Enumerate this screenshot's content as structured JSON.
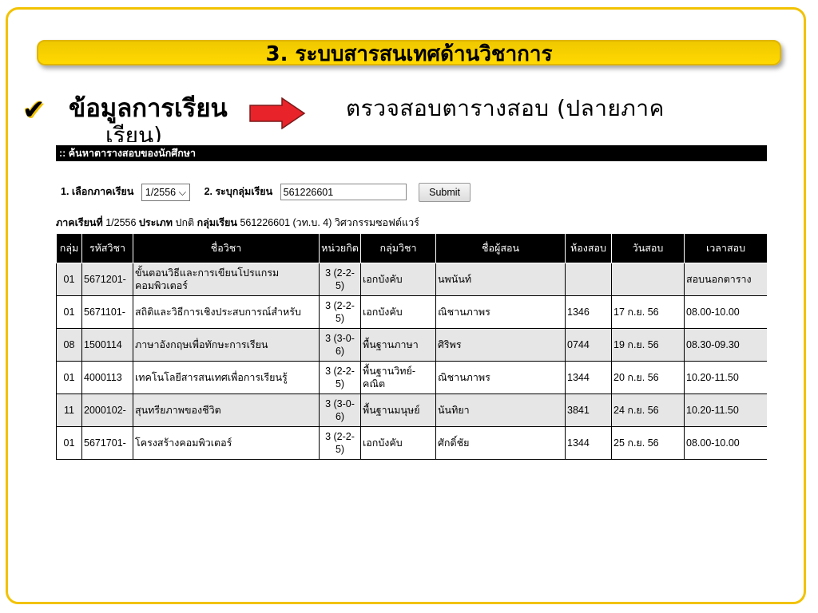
{
  "slide": {
    "title": "3. ระบบสารสนเทศด้านวิชาการ",
    "bullet_label": "ข้อมูลการเรียน",
    "bullet_text_line1": "ตรวจสอบตารางสอบ (ปลายภาค",
    "bullet_text_line2": "เรียน)"
  },
  "screen": {
    "header": ":: ค้นหาตารางสอบของนักศึกษา",
    "form": {
      "step1_label": "1.  เลือกภาคเรียน",
      "semester_value": "1/2556",
      "step2_label": "2.  ระบุกลุ่มเรียน",
      "group_value": "561226601",
      "submit_label": "Submit"
    },
    "info": {
      "semester_label": "ภาคเรียนที่",
      "semester_value": "1/2556",
      "type_label": "ประเภท",
      "type_value": "ปกติ",
      "group_label": "กลุ่มเรียน",
      "group_value": "561226601 (วท.บ. 4) วิศวกรรมซอฟต์แวร์"
    },
    "table": {
      "headers": [
        "กลุ่ม",
        "รหัสวิชา",
        "ชื่อวิชา",
        "หน่วยกิต",
        "กลุ่มวิชา",
        "ชื่อผู้สอน",
        "ห้องสอบ",
        "วันสอบ",
        "เวลาสอบ"
      ],
      "rows": [
        {
          "group": "01",
          "code": "5671201-",
          "name": "ขั้นตอนวิธีและการเขียนโปรแกรมคอมพิวเตอร์",
          "credit": "3 (2-2-5)",
          "category": "เอกบังคับ",
          "teacher": "นพนันท์",
          "room": "",
          "date": "",
          "time": "สอบนอกตาราง"
        },
        {
          "group": "01",
          "code": "5671101-",
          "name": "สถิติและวิธีการเชิงประสบการณ์สำหรับ",
          "credit": "3 (2-2-5)",
          "category": "เอกบังคับ",
          "teacher": "ณิชานภาพร",
          "room": "1346",
          "date": "17 ก.ย. 56",
          "time": "08.00-10.00"
        },
        {
          "group": "08",
          "code": "1500114",
          "name": "ภาษาอังกฤษเพื่อทักษะการเรียน",
          "credit": "3 (3-0-6)",
          "category": "พื้นฐานภาษา",
          "teacher": "ศิริพร",
          "room": "0744",
          "date": "19 ก.ย. 56",
          "time": "08.30-09.30"
        },
        {
          "group": "01",
          "code": "4000113",
          "name": "เทคโนโลยีสารสนเทศเพื่อการเรียนรู้",
          "credit": "3 (2-2-5)",
          "category": "พื้นฐานวิทย์-คณิต",
          "teacher": "ณิชานภาพร",
          "room": "1344",
          "date": "20 ก.ย. 56",
          "time": "10.20-11.50"
        },
        {
          "group": "11",
          "code": "2000102-",
          "name": "สุนทรียภาพของชีวิต",
          "credit": "3 (3-0-6)",
          "category": "พื้นฐานมนุษย์",
          "teacher": "นันทิยา",
          "room": "3841",
          "date": "24 ก.ย. 56",
          "time": "10.20-11.50"
        },
        {
          "group": "01",
          "code": "5671701-",
          "name": "โครงสร้างคอมพิวเตอร์",
          "credit": "3 (2-2-5)",
          "category": "เอกบังคับ",
          "teacher": "ศักดิ์ชัย",
          "room": "1344",
          "date": "25 ก.ย. 56",
          "time": "08.00-10.00"
        }
      ]
    }
  },
  "colors": {
    "frame": "#f2c200",
    "title_bar": "#ffd900",
    "arrow": "#e8232a",
    "table_header": "#000000",
    "row_alt": "#e6e6e6"
  },
  "icons": {
    "bullet": "check-icon",
    "pointer": "right-arrow-icon",
    "dropdown": "chevron-down-icon"
  }
}
